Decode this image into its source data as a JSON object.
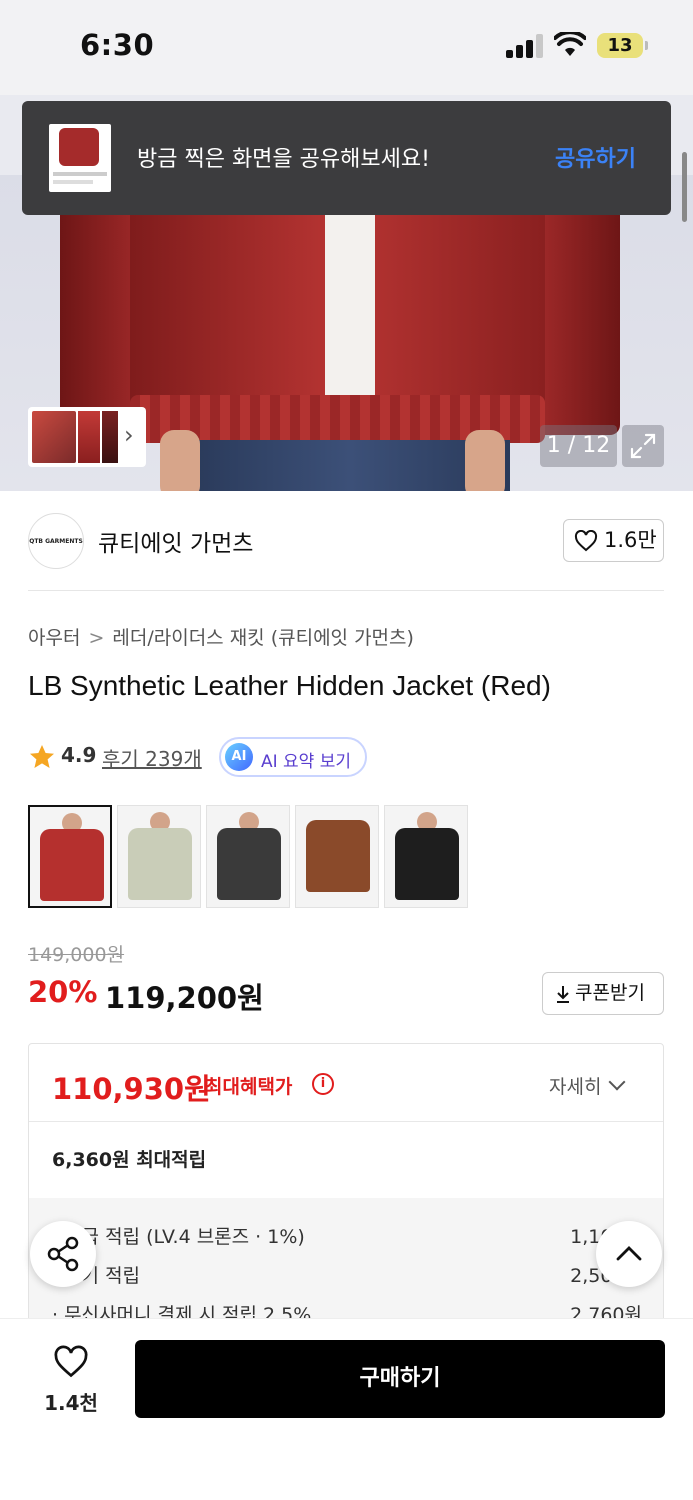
{
  "status": {
    "time": "6:30",
    "battery": "13"
  },
  "toast": {
    "message": "방금 찍은 화면을 공유해보세요!",
    "action": "공유하기"
  },
  "gallery": {
    "counter": "1 / 12"
  },
  "brand": {
    "logo_text": "QTB GARMENTS",
    "name": "큐티에잇 가먼츠",
    "likes": "1.6만"
  },
  "breadcrumb": [
    "아우터",
    "레더/라이더스 재킷 (큐티에잇 가먼츠)"
  ],
  "product": {
    "title": "LB Synthetic Leather Hidden Jacket (Red)",
    "rating": "4.9",
    "reviews": "후기 239개",
    "ai_badge": "AI",
    "ai_summary": "AI 요약 보기",
    "swatch_colors": [
      "#b5302e",
      "#c9cdb8",
      "#3a3a3a",
      "#8a4a2a",
      "#1e1e1e"
    ]
  },
  "price": {
    "original": "149,000원",
    "discount": "20%",
    "sale": "119,200원",
    "coupon": "쿠폰받기"
  },
  "benefit": {
    "max_price": "110,930원",
    "max_label": "최대혜택가",
    "detail": "자세히",
    "points": "6,360원 최대적립",
    "rows": [
      {
        "label": "· 등급 적립 (LV.4 브론즈 · 1%)",
        "amount": "1,100원"
      },
      {
        "label": "· 후기 적립",
        "amount": "2,500원"
      },
      {
        "label": "· 무신사머니 결제 시 적립 2.5%",
        "amount": "2,760원"
      }
    ]
  },
  "bottom": {
    "wish_count": "1.4천",
    "buy": "구매하기"
  },
  "colors": {
    "accent_red": "#e11d1d",
    "link_blue": "#3b82f6"
  }
}
